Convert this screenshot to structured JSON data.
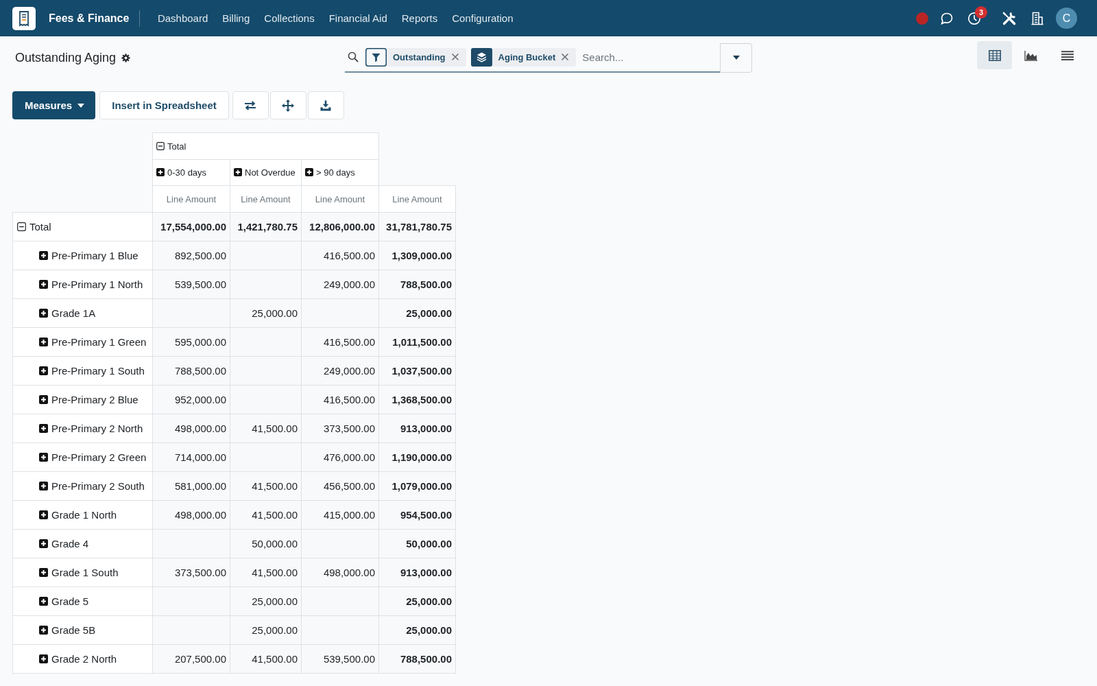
{
  "navbar": {
    "app_name": "Fees & Finance",
    "menu": [
      "Dashboard",
      "Billing",
      "Collections",
      "Financial Aid",
      "Reports",
      "Configuration"
    ],
    "notification_count": "3",
    "avatar_initial": "C"
  },
  "control_panel": {
    "title": "Outstanding Aging",
    "search": {
      "facets": [
        {
          "kind": "filter",
          "label": "Outstanding"
        },
        {
          "kind": "group",
          "label": "Aging Bucket"
        }
      ],
      "placeholder": "Search..."
    },
    "views": [
      {
        "kind": "pivot",
        "selected": true
      },
      {
        "kind": "graph",
        "selected": false
      },
      {
        "kind": "list",
        "selected": false
      }
    ]
  },
  "toolbar": {
    "measures_button": "Measures",
    "insert_button": "Insert in Spreadsheet"
  },
  "pivot": {
    "column_header": {
      "label": "Total",
      "expanded": true,
      "children": [
        {
          "label": "0-30 days",
          "expanded": false
        },
        {
          "label": "Not Overdue",
          "expanded": false
        },
        {
          "label": "> 90 days",
          "expanded": false
        }
      ]
    },
    "measures": [
      "Line Amount",
      "Line Amount",
      "Line Amount",
      "Line Amount"
    ],
    "rows": [
      {
        "label": "Total",
        "expanded": true,
        "column_1": "17,554,000.00",
        "column_2": "1,421,780.75",
        "column_3": "12,806,000.00",
        "total": "31,781,780.75",
        "children": [
          {
            "label": "Pre-Primary 1 Blue",
            "expanded": false,
            "column_1": "892,500.00",
            "column_3": "416,500.00",
            "total": "1,309,000.00"
          },
          {
            "label": "Pre-Primary 1 North",
            "expanded": false,
            "column_1": "539,500.00",
            "column_3": "249,000.00",
            "total": "788,500.00"
          },
          {
            "label": "Grade 1A",
            "expanded": false,
            "column_2": "25,000.00",
            "total": "25,000.00"
          },
          {
            "label": "Pre-Primary 1 Green",
            "expanded": false,
            "column_1": "595,000.00",
            "column_3": "416,500.00",
            "total": "1,011,500.00"
          },
          {
            "label": "Pre-Primary 1 South",
            "expanded": false,
            "column_1": "788,500.00",
            "column_3": "249,000.00",
            "total": "1,037,500.00"
          },
          {
            "label": "Pre-Primary 2 Blue",
            "expanded": false,
            "column_1": "952,000.00",
            "column_3": "416,500.00",
            "total": "1,368,500.00"
          },
          {
            "label": "Pre-Primary 2 North",
            "expanded": false,
            "column_1": "498,000.00",
            "column_2": "41,500.00",
            "column_3": "373,500.00",
            "total": "913,000.00"
          },
          {
            "label": "Pre-Primary 2 Green",
            "expanded": false,
            "column_1": "714,000.00",
            "column_3": "476,000.00",
            "total": "1,190,000.00"
          },
          {
            "label": "Pre-Primary 2 South",
            "expanded": false,
            "column_1": "581,000.00",
            "column_2": "41,500.00",
            "column_3": "456,500.00",
            "total": "1,079,000.00"
          },
          {
            "label": "Grade 1 North",
            "expanded": false,
            "column_1": "498,000.00",
            "column_2": "41,500.00",
            "column_3": "415,000.00",
            "total": "954,500.00"
          },
          {
            "label": "Grade 4",
            "expanded": false,
            "column_2": "50,000.00",
            "total": "50,000.00"
          },
          {
            "label": "Grade 1 South",
            "expanded": false,
            "column_1": "373,500.00",
            "column_2": "41,500.00",
            "column_3": "498,000.00",
            "total": "913,000.00"
          },
          {
            "label": "Grade 5",
            "expanded": false,
            "column_2": "25,000.00",
            "total": "25,000.00"
          },
          {
            "label": "Grade 5B",
            "expanded": false,
            "column_2": "25,000.00",
            "total": "25,000.00"
          },
          {
            "label": "Grade 2 North",
            "expanded": false,
            "column_1": "207,500.00",
            "column_2": "41,500.00",
            "column_3": "539,500.00",
            "total": "788,500.00"
          }
        ]
      }
    ]
  }
}
